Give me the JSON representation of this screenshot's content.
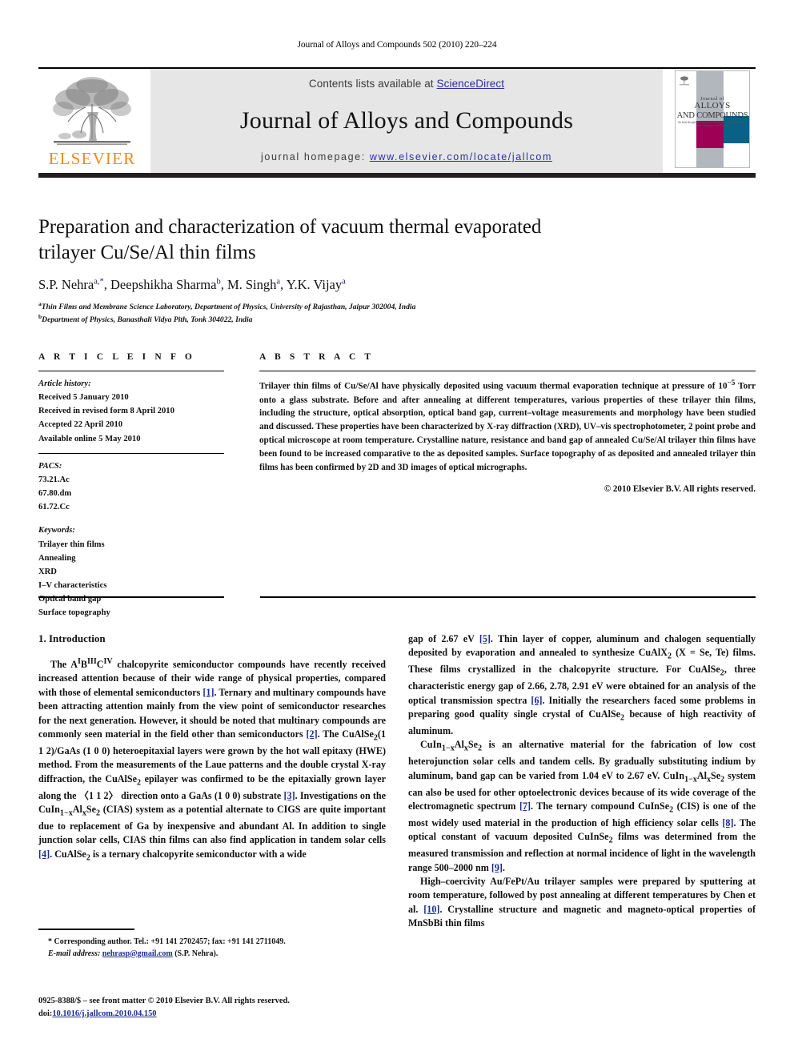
{
  "running_head": "Journal of Alloys and Compounds 502 (2010) 220–224",
  "masthead": {
    "contents_prefix": "Contents lists available at ",
    "sciencedirect": "ScienceDirect",
    "journal_title": "Journal of Alloys and Compounds",
    "homepage_prefix": "journal homepage: ",
    "homepage_url": "www.elsevier.com/locate/jallcom",
    "publisher": "ELSEVIER",
    "cover": {
      "line1": "Journal of",
      "line2": "ALLOYS",
      "line3": "AND COMPOUNDS",
      "line4": "An Interdisciplinary Journal of Materials Science and Solid-state Chemistry and Physics"
    },
    "colors": {
      "link": "#2e2ea8",
      "banner_bg": "#e6e6e6",
      "elsevier_orange": "#ec8a1e",
      "cover_magenta": "#9d0055",
      "cover_teal": "#0a6186",
      "cover_gray": "#b2b6bd",
      "rule_dark": "#231f20"
    }
  },
  "title": "Preparation and characterization of vacuum thermal evaporated trilayer Cu/Se/Al thin films",
  "authors": [
    {
      "name": "S.P. Nehra",
      "marks": "a,*"
    },
    {
      "name": "Deepshikha Sharma",
      "marks": "b"
    },
    {
      "name": "M. Singh",
      "marks": "a"
    },
    {
      "name": "Y.K. Vijay",
      "marks": "a"
    }
  ],
  "affiliations": [
    {
      "mark": "a",
      "text": "Thin Films and Membrane Science Laboratory, Department of Physics, University of Rajasthan, Jaipur 302004, India"
    },
    {
      "mark": "b",
      "text": "Department of Physics, Banasthali Vidya Pith, Tonk 304022, India"
    }
  ],
  "article_info": {
    "heading": "A R T I C L E   I N F O",
    "history_label": "Article history:",
    "history": [
      "Received 5 January 2010",
      "Received in revised form 8 April 2010",
      "Accepted 22 April 2010",
      "Available online 5 May 2010"
    ],
    "pacs_label": "PACS:",
    "pacs": [
      "73.21.Ac",
      "67.80.dm",
      "61.72.Cc"
    ],
    "keywords_label": "Keywords:",
    "keywords": [
      "Trilayer thin films",
      "Annealing",
      "XRD",
      "I–V characteristics",
      "Optical band gap",
      "Surface topography"
    ]
  },
  "abstract": {
    "heading": "A B S T R A C T",
    "text_p1": "Trilayer thin films of Cu/Se/Al have physically deposited using vacuum thermal evaporation technique at pressure of 10",
    "text_exp": "−5",
    "text_p2": " Torr onto a glass substrate. Before and after annealing at different temperatures, various properties of these trilayer thin films, including the structure, optical absorption, optical band gap, current–voltage measurements and morphology have been studied and discussed. These properties have been characterized by X-ray diffraction (XRD), UV–vis spectrophotometer, 2 point probe and optical microscope at room temperature. Crystalline nature, resistance and band gap of annealed Cu/Se/Al trilayer thin films have been found to be increased comparative to the as deposited samples. Surface topography of as deposited and annealed trilayer thin films has been confirmed by 2D and 3D images of optical micrographs.",
    "copyright": "© 2010 Elsevier B.V. All rights reserved."
  },
  "body": {
    "section_title": "1. Introduction",
    "left_paragraph_parts": {
      "p1_a": "The A",
      "p1_sup1": "I",
      "p1_b": "B",
      "p1_sup2": "III",
      "p1_c": "C",
      "p1_sup3": "IV",
      "p1_d": " chalcopyrite semiconductor compounds have recently received increased attention because of their wide range of physical properties, compared with those of elemental semiconductors ",
      "ref1": "[1]",
      "p1_e": ". Ternary and multinary compounds have been attracting attention mainly from the view point of semiconductor researches for the next generation. However, it should be noted that multinary compounds are commonly seen material in the field other than semiconductors ",
      "ref2": "[2]",
      "p1_f": ". The CuAlSe",
      "sub2a": "2",
      "p1_g": "(1 1 2)/GaAs (1 0 0) heteroepitaxial layers were grown by the hot wall epitaxy (HWE) method. From the measurements of the Laue patterns and the double crystal X-ray diffraction, the CuAlSe",
      "sub2b": "2",
      "p1_h": " epilayer was confirmed to be the epitaxially grown layer along the 〈1 1 2〉 direction onto a GaAs (1 0 0) substrate ",
      "ref3": "[3]",
      "p1_i": ". Investigations on the CuIn",
      "sub1x": "1−x",
      "p1_j": "Al",
      "subx": "x",
      "p1_k": "Se",
      "sub2c": "2",
      "p1_l": " (CIAS) system as a potential alternate to CIGS are quite important due to replacement of Ga by inexpensive and abundant Al. In addition to single junction solar cells, CIAS thin films can also find application in tandem solar cells ",
      "ref4": "[4]",
      "p1_m": ". CuAlSe",
      "sub2d": "2",
      "p1_n": " is a ternary chalcopyrite semiconductor with a wide"
    },
    "right_paragraph_parts": {
      "r1_a": "gap of 2.67 eV ",
      "ref5": "[5]",
      "r1_b": ". Thin layer of copper, aluminum and chalogen sequentially deposited by evaporation and annealed to synthesize CuAlX",
      "sub2a": "2",
      "r1_c": " (X = Se, Te) films. These films crystallized in the chalcopyrite structure. For CuAlSe",
      "sub2b": "2",
      "r1_d": ", three characteristic energy gap of 2.66, 2.78, 2.91 eV were obtained for an analysis of the optical transmission spectra ",
      "ref6": "[6]",
      "r1_e": ". Initially the researchers faced some problems in preparing good quality single crystal of CuAlSe",
      "sub2c": "2",
      "r1_f": " because of high reactivity of aluminum.",
      "r2_a": "CuIn",
      "sub1x": "1−x",
      "r2_b": "Al",
      "subx": "x",
      "r2_c": "Se",
      "sub2d": "2",
      "r2_d": " is an alternative material for the fabrication of low cost heterojunction solar cells and tandem cells. By gradually substituting indium by aluminum, band gap can be varied from 1.04 eV to 2.67 eV. CuIn",
      "sub1x2": "1−x",
      "r2_e": "Al",
      "subx2": "x",
      "r2_f": "Se",
      "sub2e": "2",
      "r2_g": " system can also be used for other optoelectronic devices because of its wide coverage of the electromagnetic spectrum ",
      "ref7": "[7]",
      "r2_h": ". The ternary compound CuInSe",
      "sub2f": "2",
      "r2_i": " (CIS) is one of the most widely used material in the production of high efficiency solar cells ",
      "ref8": "[8]",
      "r2_j": ". The optical constant of vacuum deposited CuInSe",
      "sub2g": "2",
      "r2_k": " films was determined from the measured transmission and reflection at normal incidence of light in the wavelength range 500–2000 nm ",
      "ref9": "[9]",
      "r2_l": ".",
      "r3_a": "High–coercivity Au/FePt/Au trilayer samples were prepared by sputtering at room temperature, followed by post annealing at different temperatures by Chen et al. ",
      "ref10": "[10]",
      "r3_b": ". Crystalline structure and magnetic and magneto-optical properties of MnSbBi thin films"
    }
  },
  "footnote": {
    "corresponding": "* Corresponding author. Tel.: +91 141 2702457; fax: +91 141 2711049.",
    "email_label": "E-mail address:",
    "email": "nehrasp@gmail.com",
    "email_suffix": " (S.P. Nehra)."
  },
  "imprint": {
    "line1": "0925-8388/$ – see front matter © 2010 Elsevier B.V. All rights reserved.",
    "doi_label": "doi:",
    "doi": "10.1016/j.jallcom.2010.04.150"
  }
}
